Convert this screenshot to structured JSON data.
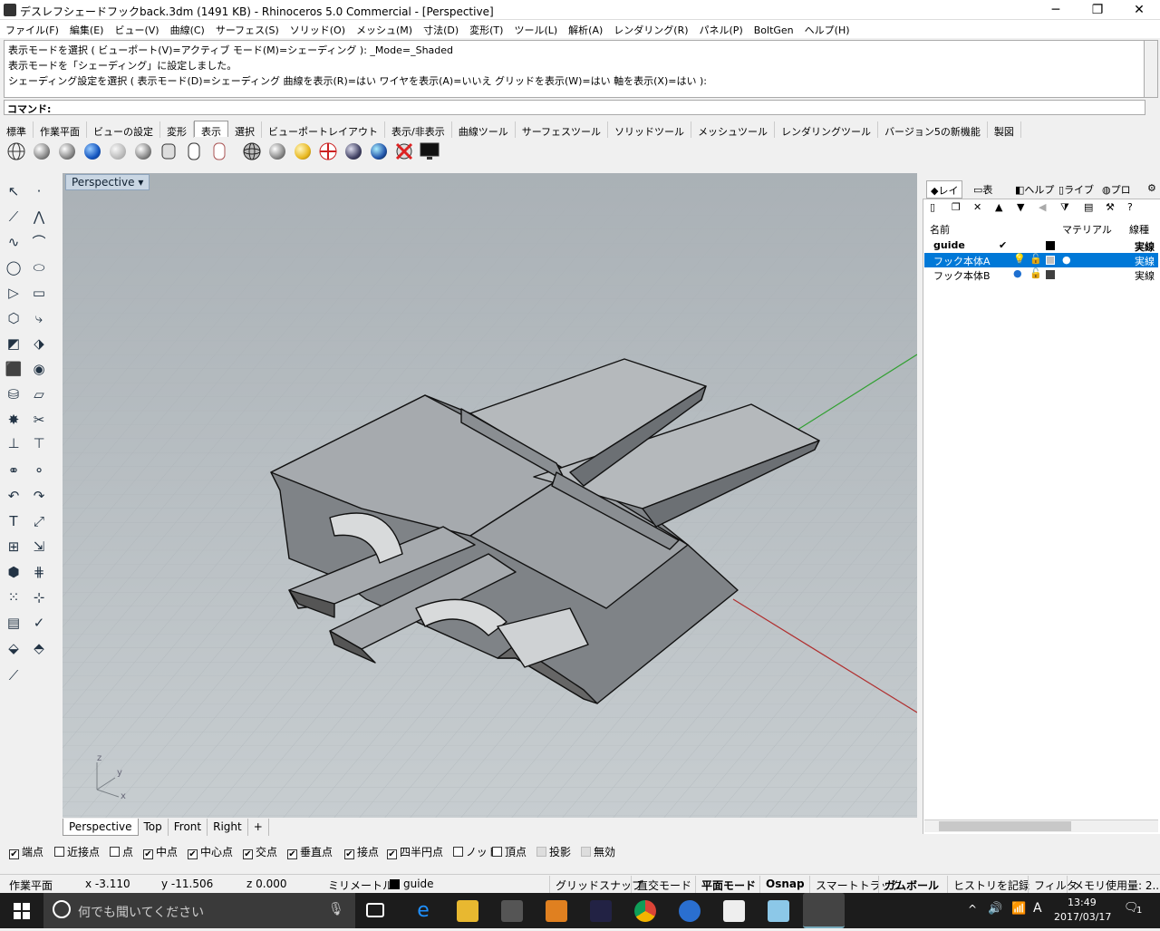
{
  "window": {
    "title": "デスレフシェードフックback.3dm (1491 KB) - Rhinoceros 5.0 Commercial - [Perspective]",
    "minimize": "─",
    "maximize": "❐",
    "close": "✕"
  },
  "menu": [
    "ファイル(F)",
    "編集(E)",
    "ビュー(V)",
    "曲線(C)",
    "サーフェス(S)",
    "ソリッド(O)",
    "メッシュ(M)",
    "寸法(D)",
    "変形(T)",
    "ツール(L)",
    "解析(A)",
    "レンダリング(R)",
    "パネル(P)",
    "BoltGen",
    "ヘルプ(H)"
  ],
  "command_history": [
    "表示モードを選択 ( ビューポート(V)=アクティブ モード(M)=シェーディング ): _Mode=_Shaded",
    "表示モードを「シェーディング」に設定しました。",
    "シェーディング設定を選択 ( 表示モード(D)=シェーディング 曲線を表示(R)=はい ワイヤを表示(A)=いいえ グリッドを表示(W)=はい 軸を表示(X)=はい ):"
  ],
  "command_prompt": "コマンド:",
  "toolbar_tabs": [
    "標準",
    "作業平面",
    "ビューの設定",
    "変形",
    "表示",
    "選択",
    "ビューポートレイアウト",
    "表示/非表示",
    "曲線ツール",
    "サーフェスツール",
    "ソリッドツール",
    "メッシュツール",
    "レンダリングツール",
    "バージョン5の新機能",
    "製図"
  ],
  "active_toolbar_tab": "表示",
  "viewport": {
    "title": "Perspective",
    "tabs": [
      "Perspective",
      "Top",
      "Front",
      "Right"
    ],
    "add_tab": "+",
    "axis_labels": {
      "z": "z",
      "y": "y",
      "x": "x"
    }
  },
  "right_panel": {
    "tabs": [
      "レイ",
      "表",
      "ヘルプ",
      "ライブ",
      "プロ"
    ],
    "headers": {
      "name": "名前",
      "material": "マテリアル",
      "linetype": "線種"
    },
    "layers": [
      {
        "name": "guide",
        "current": "✔",
        "color": "#000000",
        "linetype": "実線",
        "selected": false
      },
      {
        "name": "フック本体A",
        "current": "",
        "color": "#c0c0c0",
        "linetype": "実線",
        "selected": true
      },
      {
        "name": "フック本体B",
        "current": "",
        "color": "#404040",
        "linetype": "実線",
        "selected": false
      }
    ]
  },
  "osnap": [
    {
      "label": "端点",
      "checked": true
    },
    {
      "label": "近接点",
      "checked": false
    },
    {
      "label": "点",
      "checked": false
    },
    {
      "label": "中点",
      "checked": true
    },
    {
      "label": "中心点",
      "checked": true
    },
    {
      "label": "交点",
      "checked": true
    },
    {
      "label": "垂直点",
      "checked": true
    },
    {
      "label": "接点",
      "checked": true
    },
    {
      "label": "四半円点",
      "checked": true
    },
    {
      "label": "ノット",
      "checked": false
    },
    {
      "label": "頂点",
      "checked": false
    },
    {
      "label": "投影",
      "checked": false
    },
    {
      "label": "無効",
      "checked": false
    }
  ],
  "status": {
    "cplane": "作業平面",
    "x": "x -3.110",
    "y": "y -11.506",
    "z": "z 0.000",
    "units": "ミリメートル",
    "layer": "guide",
    "buttons": [
      "グリッドスナップ",
      "直交モード",
      "平面モード",
      "Osnap",
      "スマートトラック",
      "ガムボール",
      "ヒストリを記録",
      "フィルタ",
      "メモリ使用量: 2..."
    ]
  },
  "taskbar": {
    "search_placeholder": "何でも聞いてください",
    "time": "13:49",
    "date": "2017/03/17",
    "ime": "A",
    "notifications": "1"
  },
  "colors": {
    "x_axis": "#b03030",
    "y_axis": "#30a030",
    "selection": "#0078d7",
    "viewport_bg": "#bcc3c7"
  }
}
